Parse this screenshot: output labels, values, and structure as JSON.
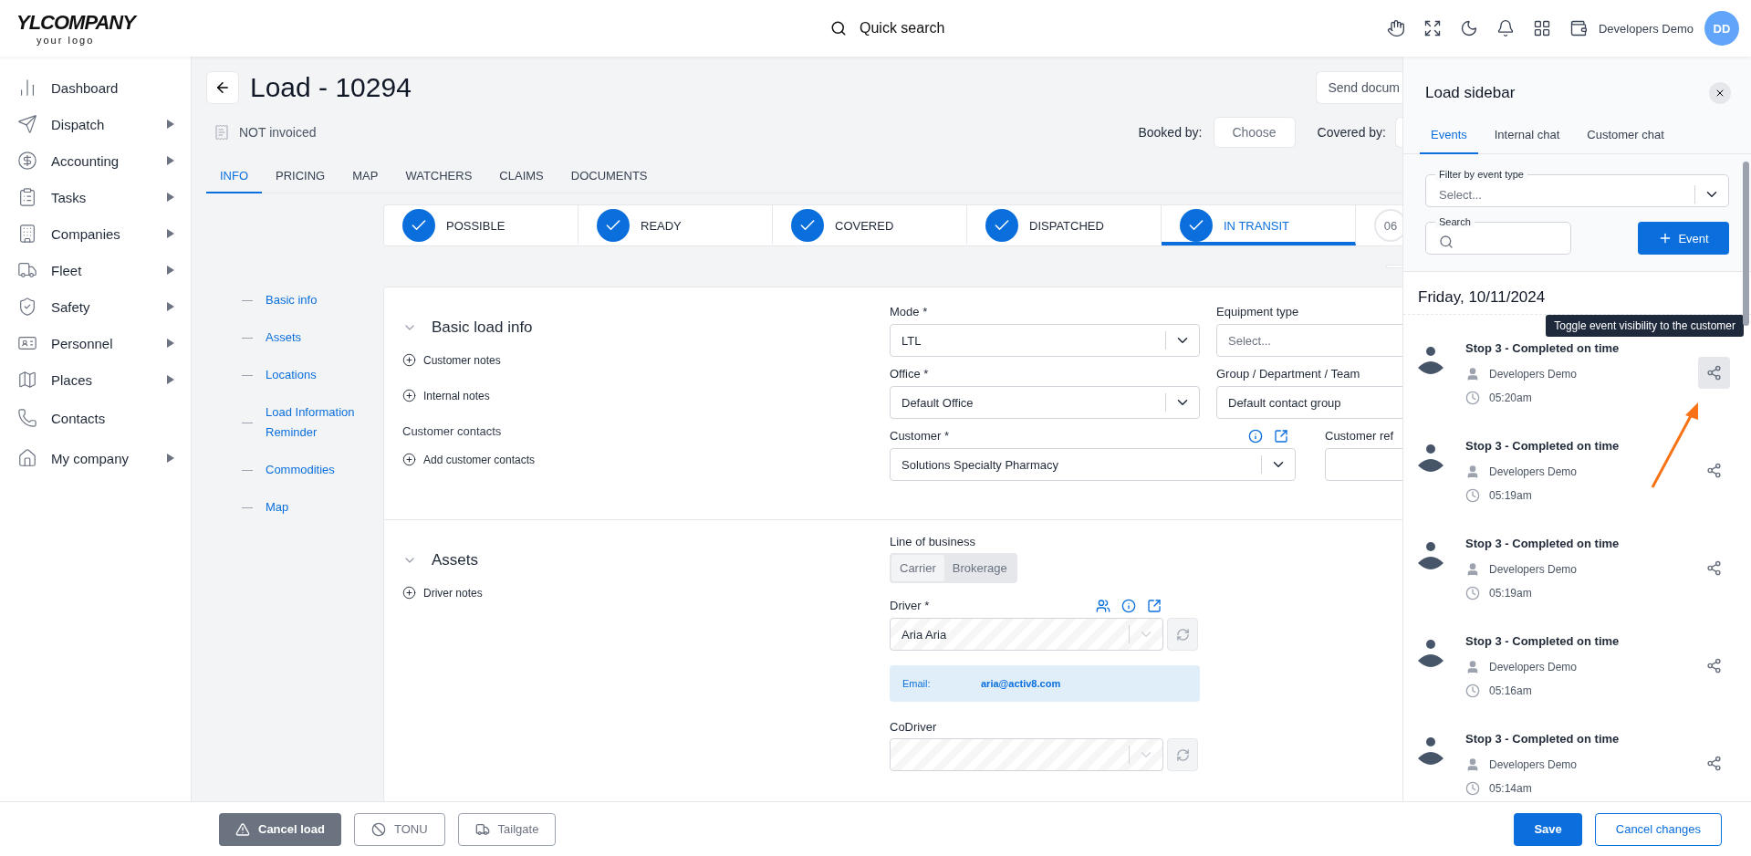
{
  "logo": {
    "main": "YLCOMPANY",
    "sub": "your logo"
  },
  "quick_search": {
    "label": "Quick search"
  },
  "user": {
    "name": "Developers Demo",
    "initials": "DD"
  },
  "nav": [
    {
      "label": "Dashboard",
      "kind": "chart",
      "has_submenu": false
    },
    {
      "label": "Dispatch",
      "kind": "send",
      "has_submenu": true
    },
    {
      "label": "Accounting",
      "kind": "dollar",
      "has_submenu": true
    },
    {
      "label": "Tasks",
      "kind": "clipboard",
      "has_submenu": true
    },
    {
      "label": "Companies",
      "kind": "building",
      "has_submenu": true
    },
    {
      "label": "Fleet",
      "kind": "truck",
      "has_submenu": true
    },
    {
      "label": "Safety",
      "kind": "shield",
      "has_submenu": true
    },
    {
      "label": "Personnel",
      "kind": "idcard",
      "has_submenu": true
    },
    {
      "label": "Places",
      "kind": "map",
      "has_submenu": true
    },
    {
      "label": "Contacts",
      "kind": "phone",
      "has_submenu": false
    },
    {
      "label": "My company",
      "kind": "home",
      "has_submenu": true
    }
  ],
  "page": {
    "title": "Load - 10294",
    "invoice_status": "NOT invoiced",
    "send_button": "Send docum",
    "booked_by_label": "Booked by:",
    "booked_by_button": "Choose",
    "covered_by_label": "Covered by:"
  },
  "tabs": [
    {
      "label": "INFO",
      "selected": true
    },
    {
      "label": "PRICING",
      "selected": false
    },
    {
      "label": "MAP",
      "selected": false
    },
    {
      "label": "WATCHERS",
      "selected": false
    },
    {
      "label": "CLAIMS",
      "selected": false
    },
    {
      "label": "DOCUMENTS",
      "selected": false
    }
  ],
  "steps": [
    {
      "label": "POSSIBLE",
      "done": true,
      "selected": false
    },
    {
      "label": "READY",
      "done": true,
      "selected": false
    },
    {
      "label": "COVERED",
      "done": true,
      "selected": false
    },
    {
      "label": "DISPATCHED",
      "done": true,
      "selected": false
    },
    {
      "label": "IN TRANSIT",
      "done": true,
      "selected": true
    },
    {
      "label": "06",
      "done": false,
      "selected": false
    }
  ],
  "section_nav": [
    "Basic info",
    "Assets",
    "Locations",
    "Load Information Reminder",
    "Commodities",
    "Map"
  ],
  "basic_load_info": {
    "title": "Basic load info",
    "expanded": true,
    "actions": [
      "Customer notes",
      "Internal notes"
    ],
    "contacts_label": "Customer contacts",
    "contacts_action": "Add customer contacts",
    "rows": [
      [
        {
          "label": "Mode *",
          "value": "LTL",
          "kind": "select"
        },
        {
          "label": "Equipment type",
          "placeholder": "Select...",
          "kind": "select"
        }
      ],
      [
        {
          "label": "Office *",
          "value": "Default Office",
          "kind": "select"
        },
        {
          "label": "Group / Department / Team",
          "value": "Default contact group",
          "kind": "text"
        }
      ],
      [
        {
          "label": "Customer *",
          "value": "Solutions Specialty Pharmacy",
          "kind": "customer"
        },
        {
          "label": "Customer ref",
          "kind": "text"
        }
      ]
    ]
  },
  "assets": {
    "title": "Assets",
    "expanded": true,
    "actions": [
      "Driver notes"
    ],
    "line_of_business": {
      "label": "Line of business",
      "options": [
        {
          "label": "Carrier",
          "selected": true
        },
        {
          "label": "Brokerage",
          "selected": false
        }
      ]
    },
    "driver": {
      "label": "Driver *",
      "value": "Aria Aria",
      "disabled": true
    },
    "email": {
      "label": "Email:",
      "value": "aria@activ8.com"
    },
    "codriver": {
      "label": "CoDriver",
      "disabled": true
    }
  },
  "load_sidebar": {
    "title": "Load sidebar",
    "tabs": [
      {
        "label": "Events",
        "selected": true
      },
      {
        "label": "Internal chat",
        "selected": false
      },
      {
        "label": "Customer chat",
        "selected": false
      }
    ],
    "filter": {
      "label": "Filter by event type",
      "placeholder": "Select..."
    },
    "search": {
      "label": "Search"
    },
    "add_button": "Event",
    "date": "Friday, 10/11/2024",
    "events": [
      {
        "title": "Stop 3 - Completed on time",
        "author": "Developers Demo",
        "time": "05:20am",
        "tooltip": "Toggle event visibility to the customer"
      },
      {
        "title": "Stop 3 - Completed on time",
        "author": "Developers Demo",
        "time": "05:19am"
      },
      {
        "title": "Stop 3 - Completed on time",
        "author": "Developers Demo",
        "time": "05:19am"
      },
      {
        "title": "Stop 3 - Completed on time",
        "author": "Developers Demo",
        "time": "05:16am"
      },
      {
        "title": "Stop 3 - Completed on time",
        "author": "Developers Demo",
        "time": "05:14am"
      }
    ]
  },
  "footer": {
    "left": [
      {
        "label": "Cancel load",
        "kind": "danger"
      },
      {
        "label": "TONU",
        "kind": "ban"
      },
      {
        "label": "Tailgate",
        "kind": "truck"
      }
    ],
    "right": [
      {
        "label": "Save",
        "kind": "primary"
      },
      {
        "label": "Cancel changes",
        "kind": "outline"
      }
    ]
  }
}
